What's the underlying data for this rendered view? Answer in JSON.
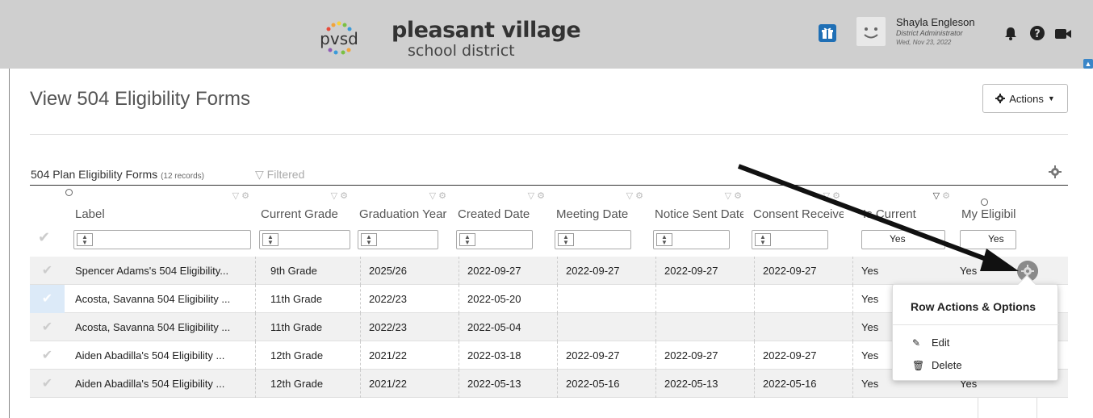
{
  "header": {
    "logo_mark": "pvsd",
    "logo_line1": "pleasant village",
    "logo_line2": "school district",
    "user_name": "Shayla Engleson",
    "user_role": "District Administrator",
    "user_date": "Wed, Nov 23, 2022"
  },
  "page": {
    "title": "View 504 Eligibility Forms",
    "actions_label": "Actions"
  },
  "grid": {
    "title": "504 Plan Eligibility Forms",
    "count": "(12 records)",
    "filtered": "Filtered",
    "columns": [
      {
        "label": "Label",
        "filter": ""
      },
      {
        "label": "Current Grade",
        "filter": ""
      },
      {
        "label": "Graduation Year",
        "filter": ""
      },
      {
        "label": "Created Date",
        "filter": ""
      },
      {
        "label": "Meeting Date",
        "filter": ""
      },
      {
        "label": "Notice Sent Date",
        "filter": ""
      },
      {
        "label": "Consent Received",
        "filter": ""
      },
      {
        "label": "Is Current",
        "filter": "Yes"
      },
      {
        "label": "My Eligibility",
        "filter": "Yes"
      }
    ],
    "rows": [
      [
        "Spencer Adams's 504 Eligibility...",
        "9th Grade",
        "2025/26",
        "2022-09-27",
        "2022-09-27",
        "2022-09-27",
        "2022-09-27",
        "Yes",
        "Yes"
      ],
      [
        "Acosta, Savanna 504 Eligibility ...",
        "11th Grade",
        "2022/23",
        "2022-05-20",
        "",
        "",
        "",
        "Yes",
        ""
      ],
      [
        "Acosta, Savanna 504 Eligibility ...",
        "11th Grade",
        "2022/23",
        "2022-05-04",
        "",
        "",
        "",
        "Yes",
        ""
      ],
      [
        "Aiden Abadilla's 504 Eligibility ...",
        "12th Grade",
        "2021/22",
        "2022-03-18",
        "2022-09-27",
        "2022-09-27",
        "2022-09-27",
        "Yes",
        ""
      ],
      [
        "Aiden Abadilla's 504 Eligibility ...",
        "12th Grade",
        "2021/22",
        "2022-05-13",
        "2022-05-16",
        "2022-05-13",
        "2022-05-16",
        "Yes",
        "Yes"
      ]
    ]
  },
  "popup": {
    "title": "Row Actions & Options",
    "edit": "Edit",
    "delete": "Delete"
  },
  "colors": {
    "topbar": "#cfcfcf",
    "gift": "#1f6fb5",
    "row_alt": "#f1f1f1",
    "selected_check": "#dceaf8"
  }
}
